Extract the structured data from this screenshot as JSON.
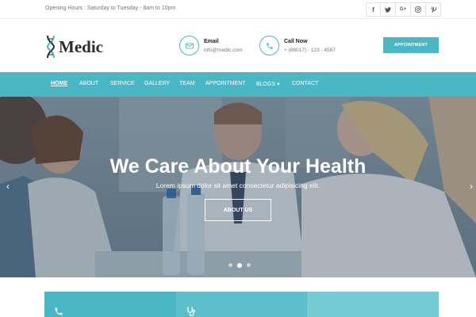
{
  "topbar": {
    "hours": "Opening Hours : Saturday to Tuesday - 8am to 10pm",
    "social": [
      {
        "icon": "facebook-icon",
        "glyph": "f"
      },
      {
        "icon": "twitter-icon",
        "glyph": "🐦"
      },
      {
        "icon": "google-plus-icon",
        "glyph": "G+"
      },
      {
        "icon": "instagram-icon",
        "glyph": "◎"
      },
      {
        "icon": "pinterest-icon",
        "glyph": "℗"
      }
    ]
  },
  "header": {
    "logo": "Medic",
    "email_label": "Email",
    "email_value": "info@medic.com",
    "call_label": "Call Now",
    "call_value": "+ (88017) - 123 - 4567",
    "appointment_button": "APPOINTMENT"
  },
  "nav": {
    "items": [
      "HOME",
      "ABOUT",
      "SERVICE",
      "GALLERY",
      "TEAM",
      "APPOINTMENT",
      "BLOGS ▾",
      "CONTACT"
    ]
  },
  "hero": {
    "title": "We Care About Your Health",
    "subtitle": "Lorem ipsum dolor sit amet consectetur adipisicing elit.",
    "button": "ABOUT US",
    "prev": "‹",
    "next": "›"
  },
  "colors": {
    "accent": "#49b8c4",
    "feature_1": "#49b8c4",
    "feature_2": "#5cc0cb",
    "feature_3": "#74cbd3"
  }
}
